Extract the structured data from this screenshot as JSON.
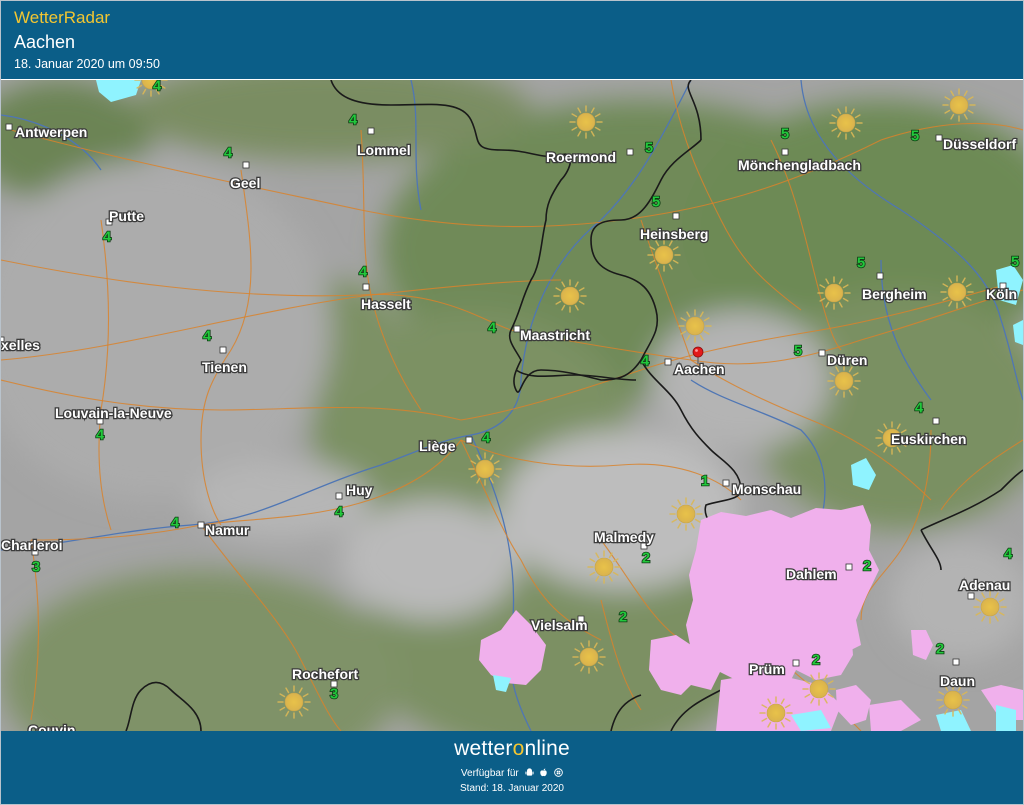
{
  "header": {
    "brand": "WetterRadar",
    "place": "Aachen",
    "datetime": "18. Januar 2020 um 09:50"
  },
  "footer": {
    "logo_prefix": "wetter",
    "logo_o": "o",
    "logo_suffix": "nline",
    "available_label": "Verfügbar für",
    "platform_icons": [
      "android-icon",
      "apple-icon",
      "windows-icon"
    ],
    "stand": "Stand: 18. Januar 2020"
  },
  "colors": {
    "header_bg": "#0b5e88",
    "brand_yellow": "#f3c631",
    "forecast_number": "#22c83c",
    "road": "#d9822b",
    "border": "#1a1a1a",
    "river": "#4f76b4",
    "snow": "#f0b0ec",
    "cold_precip": "#8ff3ff"
  },
  "cities": [
    {
      "name": "Antwerpen",
      "slug": "antwerpen"
    },
    {
      "name": "Lommel",
      "slug": "lommel"
    },
    {
      "name": "Roermond",
      "slug": "roermond"
    },
    {
      "name": "Mönchengladbach",
      "slug": "moenchengladbach"
    },
    {
      "name": "Düsseldorf",
      "slug": "duesseldorf"
    },
    {
      "name": "Geel",
      "slug": "geel"
    },
    {
      "name": "Putte",
      "slug": "putte"
    },
    {
      "name": "Heinsberg",
      "slug": "heinsberg"
    },
    {
      "name": "Hasselt",
      "slug": "hasselt"
    },
    {
      "name": "Bergheim",
      "slug": "bergheim"
    },
    {
      "name": "Köln",
      "slug": "koeln"
    },
    {
      "name": "Maastricht",
      "slug": "maastricht"
    },
    {
      "name": "xelles",
      "slug": "xelles"
    },
    {
      "name": "Tienen",
      "slug": "tienen"
    },
    {
      "name": "Aachen",
      "slug": "aachen"
    },
    {
      "name": "Düren",
      "slug": "dueren"
    },
    {
      "name": "Louvain-la-Neuve",
      "slug": "louvain-la-neuve"
    },
    {
      "name": "Liège",
      "slug": "liege"
    },
    {
      "name": "Euskirchen",
      "slug": "euskirchen"
    },
    {
      "name": "Huy",
      "slug": "huy"
    },
    {
      "name": "Monschau",
      "slug": "monschau"
    },
    {
      "name": "Namur",
      "slug": "namur"
    },
    {
      "name": "Charleroi",
      "slug": "charleroi"
    },
    {
      "name": "Malmedy",
      "slug": "malmedy"
    },
    {
      "name": "Dahlem",
      "slug": "dahlem"
    },
    {
      "name": "Adenau",
      "slug": "adenau"
    },
    {
      "name": "Vielsalm",
      "slug": "vielsalm"
    },
    {
      "name": "Rochefort",
      "slug": "rochefort"
    },
    {
      "name": "Prüm",
      "slug": "pruem"
    },
    {
      "name": "Daun",
      "slug": "daun"
    },
    {
      "name": "Couvin",
      "slug": "couvin"
    }
  ],
  "forecast_numbers": [
    {
      "id": "n01",
      "value": "4"
    },
    {
      "id": "n02",
      "value": "4"
    },
    {
      "id": "n03",
      "value": "5"
    },
    {
      "id": "n04",
      "value": "5"
    },
    {
      "id": "n05",
      "value": "5"
    },
    {
      "id": "n06",
      "value": "4"
    },
    {
      "id": "n07",
      "value": "4"
    },
    {
      "id": "n08",
      "value": "5"
    },
    {
      "id": "n09",
      "value": "4"
    },
    {
      "id": "n10",
      "value": "5"
    },
    {
      "id": "n11",
      "value": "5"
    },
    {
      "id": "n12",
      "value": "4"
    },
    {
      "id": "n13",
      "value": "4"
    },
    {
      "id": "n14",
      "value": "4"
    },
    {
      "id": "n15",
      "value": "5"
    },
    {
      "id": "n16",
      "value": "4"
    },
    {
      "id": "n17",
      "value": "4"
    },
    {
      "id": "n18",
      "value": "4"
    },
    {
      "id": "n19",
      "value": "4"
    },
    {
      "id": "n20",
      "value": "1"
    },
    {
      "id": "n21",
      "value": "4"
    },
    {
      "id": "n22",
      "value": "3"
    },
    {
      "id": "n23",
      "value": "2"
    },
    {
      "id": "n24",
      "value": "2"
    },
    {
      "id": "n25",
      "value": "4"
    },
    {
      "id": "n26",
      "value": "2"
    },
    {
      "id": "n27",
      "value": "2"
    },
    {
      "id": "n28",
      "value": "2"
    },
    {
      "id": "n29",
      "value": "3"
    }
  ],
  "weather_icons": {
    "icon": "sun-icon",
    "count": 20
  },
  "location_marker": {
    "icon": "location-pin-icon",
    "place": "Aachen"
  }
}
